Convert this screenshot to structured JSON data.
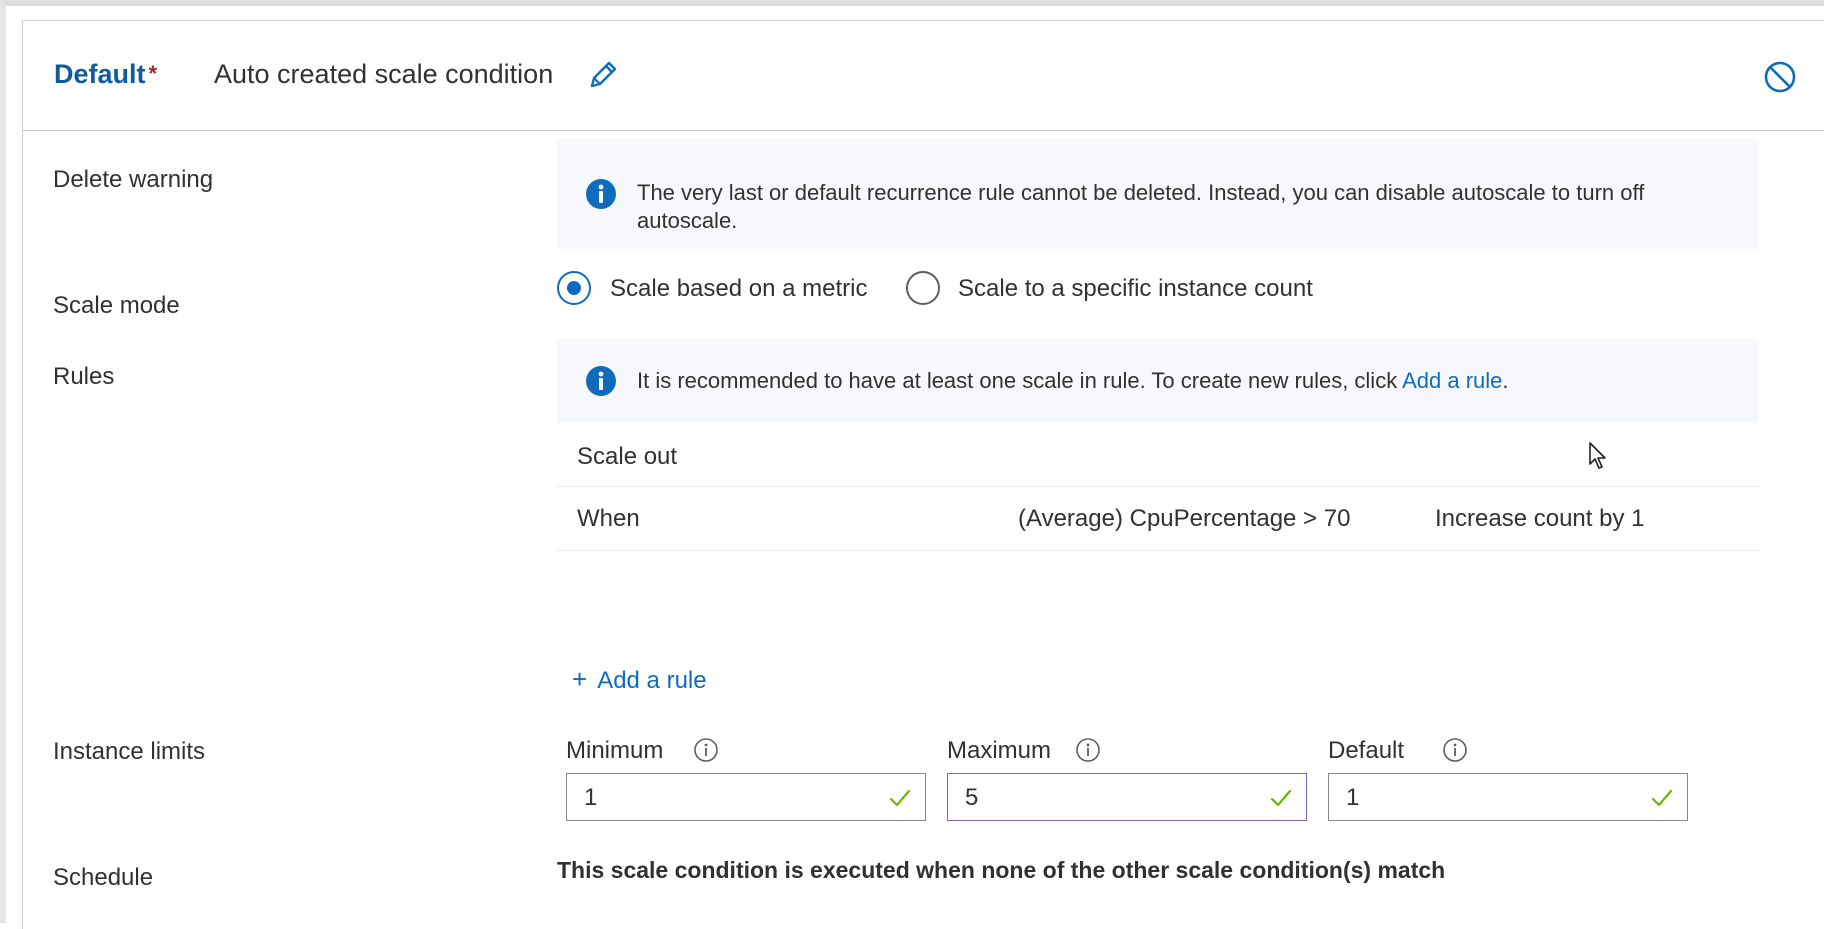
{
  "header": {
    "title": "Default",
    "asterisk": "*",
    "subtitle": "Auto created scale condition"
  },
  "delete_warning": {
    "label": "Delete warning",
    "message": "The very last or default recurrence rule cannot be deleted. Instead, you can disable autoscale to turn off autoscale."
  },
  "scale_mode": {
    "label": "Scale mode",
    "options": [
      {
        "label": "Scale based on a metric",
        "selected": true
      },
      {
        "label": "Scale to a specific instance count",
        "selected": false
      }
    ]
  },
  "rules": {
    "label": "Rules",
    "info_text": "It is recommended to have at least one scale in rule. To create new rules, click ",
    "info_link": "Add a rule",
    "info_trailing": ".",
    "section_header": "Scale out",
    "rows": [
      {
        "when": "When",
        "condition": "(Average) CpuPercentage > 70",
        "action": "Increase count by 1"
      }
    ],
    "add_rule_plus": "+",
    "add_rule_label": "Add a rule"
  },
  "instance_limits": {
    "label": "Instance limits",
    "minimum": {
      "label": "Minimum",
      "value": "1"
    },
    "maximum": {
      "label": "Maximum",
      "value": "5"
    },
    "default": {
      "label": "Default",
      "value": "1"
    }
  },
  "schedule": {
    "label": "Schedule",
    "text": "This scale condition is executed when none of the other scale condition(s) match"
  },
  "colors": {
    "accent": "#0f6cbd",
    "title": "#0f5b9c",
    "required": "#a4262c",
    "success": "#6bb700",
    "focus": "#8764b8"
  }
}
